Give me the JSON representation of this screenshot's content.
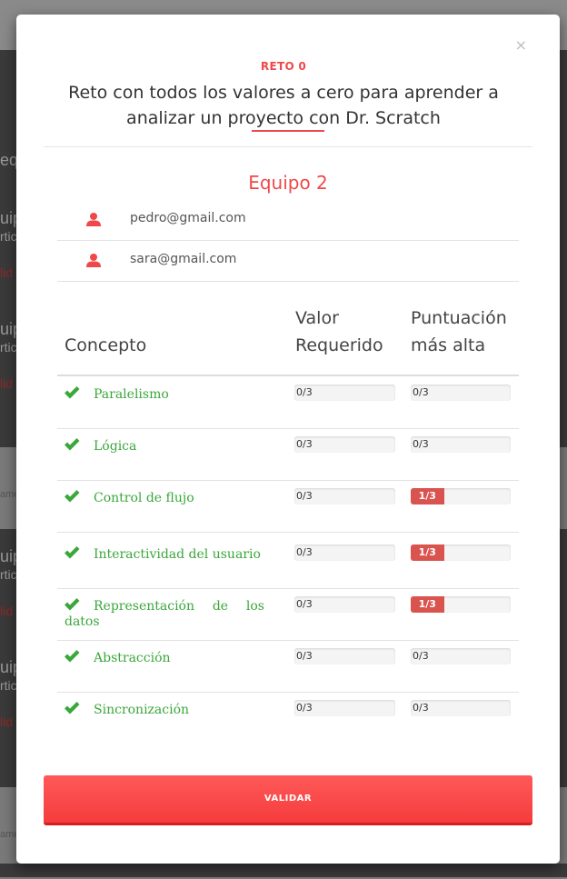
{
  "background": {
    "fragments": [
      "eq",
      "uip",
      "rtic",
      "lid",
      "uip",
      "rtic",
      "lid",
      "ame",
      "uip",
      "rtic",
      "lid",
      "uip",
      "rtic",
      "lid",
      "ame"
    ]
  },
  "modal": {
    "close_symbol": "×",
    "reto_label": "RETO 0",
    "title": "Reto con todos los valores a cero para aprender a analizar un proyecto con Dr. Scratch",
    "team_name": "Equipo 2",
    "members": [
      {
        "icon": "user-icon",
        "email": "pedro@gmail.com"
      },
      {
        "icon": "user-icon",
        "email": "sara@gmail.com"
      }
    ],
    "table": {
      "headers": {
        "concept": "Concepto",
        "required_line1": "Valor",
        "required_line2": "Requerido",
        "highest_line1": "Puntuación",
        "highest_line2": "más alta"
      },
      "rows": [
        {
          "concept": "Paralelismo",
          "required": "0/3",
          "highest": "0/3",
          "highest_fraction": 0
        },
        {
          "concept": "Lógica",
          "required": "0/3",
          "highest": "0/3",
          "highest_fraction": 0
        },
        {
          "concept": "Control de flujo",
          "required": "0/3",
          "highest": "1/3",
          "highest_fraction": 0.333
        },
        {
          "concept": "Interactividad del usuario",
          "required": "0/3",
          "highest": "1/3",
          "highest_fraction": 0.333
        },
        {
          "concept": "Representación de los datos",
          "required": "0/3",
          "highest": "1/3",
          "highest_fraction": 0.333
        },
        {
          "concept": "Abstracción",
          "required": "0/3",
          "highest": "0/3",
          "highest_fraction": 0
        },
        {
          "concept": "Sincronización",
          "required": "0/3",
          "highest": "0/3",
          "highest_fraction": 0
        }
      ]
    },
    "validate_label": "VALIDAR"
  },
  "colors": {
    "accent": "#f04848",
    "check_green": "#3aa73a",
    "progress_red": "#d9534f"
  }
}
